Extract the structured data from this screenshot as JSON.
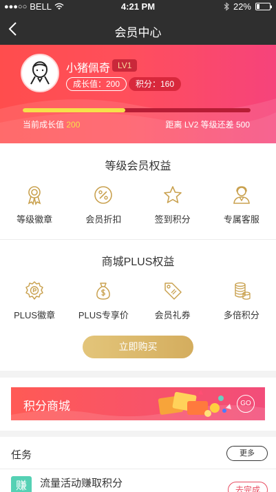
{
  "status_bar": {
    "signal": "●●●○○",
    "carrier": "BELL",
    "time": "4:21 PM",
    "battery": "22%"
  },
  "nav": {
    "title": "会员中心"
  },
  "profile": {
    "username": "小猪佩奇",
    "level": "LV1",
    "growth_pill": "成长值：200",
    "points_pill": "积分：160",
    "progress_fraction": 0.45,
    "current_growth_label": "当前成长值",
    "current_growth_value": "200",
    "next_level_text": "距离 LV2 等级还差",
    "next_level_value": "500"
  },
  "level_benefits": {
    "title": "等级会员权益",
    "items": [
      {
        "label": "等级徽章",
        "icon": "medal-icon"
      },
      {
        "label": "会员折扣",
        "icon": "discount-icon"
      },
      {
        "label": "签到积分",
        "icon": "star-icon"
      },
      {
        "label": "专属客服",
        "icon": "service-icon"
      }
    ]
  },
  "plus_benefits": {
    "title": "商城PLUS权益",
    "items": [
      {
        "label": "PLUS徽章",
        "icon": "plus-badge-icon"
      },
      {
        "label": "PLUS专享价",
        "icon": "money-bag-icon"
      },
      {
        "label": "会员礼券",
        "icon": "coupon-tag-icon"
      },
      {
        "label": "多倍积分",
        "icon": "coin-stack-icon"
      }
    ],
    "buy_label": "立即购买"
  },
  "mall": {
    "title": "积分商城",
    "go_label": "GO"
  },
  "tasks": {
    "title": "任务",
    "more_label": "更多",
    "items": [
      {
        "icon_text": "赚",
        "name": "流量活动赚取积分",
        "action": "去完成"
      }
    ]
  },
  "colors": {
    "accent_gold": "#d4ad5e",
    "hero_red": "#ff4d4d",
    "progress_yellow": "#f6e04a",
    "task_green": "#55d1b4"
  }
}
